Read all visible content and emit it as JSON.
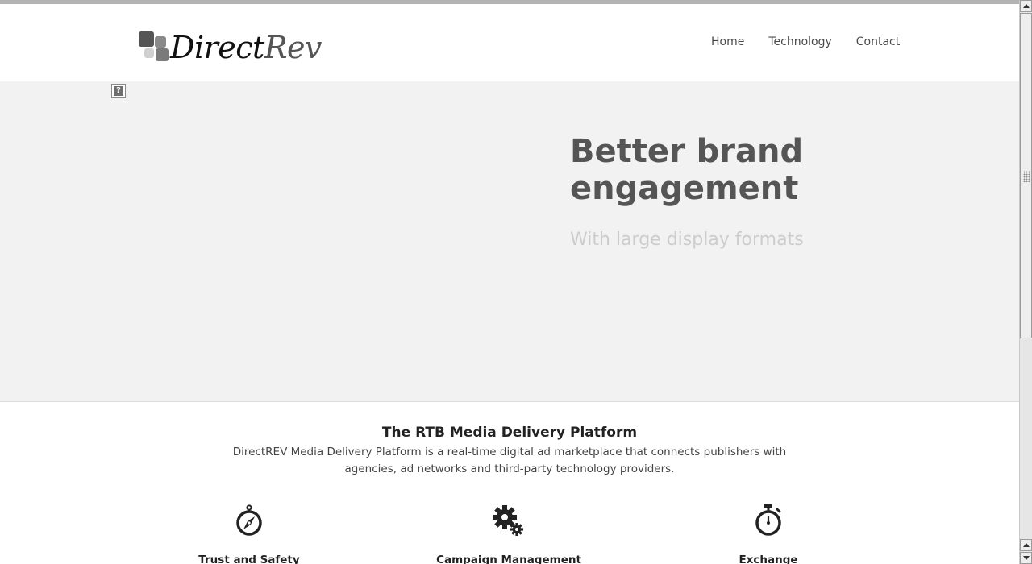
{
  "brand": {
    "logo_main": "Direct",
    "logo_accent": "Rev",
    "logo_colors": [
      "#555555",
      "#8a8a8a",
      "#bdbdbd",
      "#7a7a7a"
    ]
  },
  "nav": {
    "items": [
      {
        "label": "Home"
      },
      {
        "label": "Technology"
      },
      {
        "label": "Contact"
      }
    ]
  },
  "hero": {
    "title": "Better brand engagement",
    "subtitle": "With large display formats",
    "broken_image_glyph": "?",
    "background": "#f2f2f2"
  },
  "intro": {
    "title": "The RTB Media Delivery Platform",
    "body": "DirectREV Media Delivery Platform is a real-time digital ad marketplace that connects publishers with agencies, ad networks and third-party technology providers."
  },
  "features": [
    {
      "label": "Trust and Safety",
      "icon": "compass-icon"
    },
    {
      "label": "Campaign Management",
      "icon": "gears-icon"
    },
    {
      "label": "Exchange",
      "icon": "stopwatch-icon"
    }
  ]
}
